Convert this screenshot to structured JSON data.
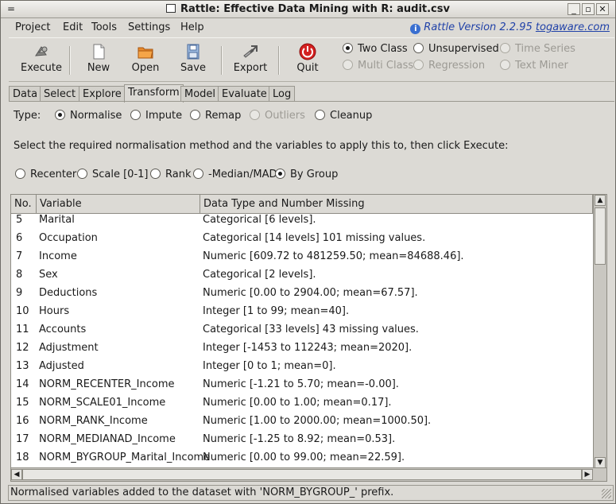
{
  "window": {
    "title": "Rattle: Effective Data Mining with R: audit.csv",
    "menu_glyph": "=",
    "btn_min": "_",
    "btn_max": "▫",
    "btn_close": "✕"
  },
  "menubar": {
    "items": [
      "Project",
      "Edit",
      "Tools",
      "Settings",
      "Help"
    ],
    "version_text": "Rattle Version 2.2.95 ",
    "version_link": "togaware.com"
  },
  "toolbar": {
    "buttons": [
      "Execute",
      "New",
      "Open",
      "Save",
      "Export",
      "Quit"
    ],
    "modes_row1": [
      "Two Class",
      "Unsupervised",
      "Time Series"
    ],
    "modes_row2": [
      "Multi Class",
      "Regression",
      "Text Miner"
    ],
    "selected_mode": "Two Class"
  },
  "tabs": [
    "Data",
    "Select",
    "Explore",
    "Transform",
    "Model",
    "Evaluate",
    "Log"
  ],
  "active_tab": "Transform",
  "type_row": {
    "label": "Type:",
    "options": [
      "Normalise",
      "Impute",
      "Remap",
      "Outliers",
      "Cleanup"
    ],
    "selected": "Normalise"
  },
  "instructions": "Select the required normalisation method and the variables to apply this to, then click Execute:",
  "methods": {
    "options": [
      "Recenter",
      "Scale [0-1]",
      "Rank",
      "-Median/MAD",
      "By Group"
    ],
    "selected": "By Group"
  },
  "table": {
    "headers": [
      "No.",
      "Variable",
      "Data Type and Number Missing"
    ],
    "rows": [
      [
        "5",
        "Marital",
        "Categorical [6 levels]."
      ],
      [
        "6",
        "Occupation",
        "Categorical [14 levels] 101 missing values."
      ],
      [
        "7",
        "Income",
        "Numeric [609.72 to 481259.50; mean=84688.46]."
      ],
      [
        "8",
        "Sex",
        "Categorical [2 levels]."
      ],
      [
        "9",
        "Deductions",
        "Numeric [0.00 to 2904.00; mean=67.57]."
      ],
      [
        "10",
        "Hours",
        "Integer [1 to 99; mean=40]."
      ],
      [
        "11",
        "Accounts",
        "Categorical [33 levels] 43 missing values."
      ],
      [
        "12",
        "Adjustment",
        "Integer [-1453 to 112243; mean=2020]."
      ],
      [
        "13",
        "Adjusted",
        "Integer [0 to 1; mean=0]."
      ],
      [
        "14",
        "NORM_RECENTER_Income",
        "Numeric [-1.21 to 5.70; mean=-0.00]."
      ],
      [
        "15",
        "NORM_SCALE01_Income",
        "Numeric [0.00 to 1.00; mean=0.17]."
      ],
      [
        "16",
        "NORM_RANK_Income",
        "Numeric [1.00 to 2000.00; mean=1000.50]."
      ],
      [
        "17",
        "NORM_MEDIANAD_Income",
        "Numeric [-1.25 to 8.92; mean=0.53]."
      ],
      [
        "18",
        "NORM_BYGROUP_Marital_Income",
        "Numeric [0.00 to 99.00; mean=22.59]."
      ]
    ]
  },
  "status": "Normalised variables added to the dataset with 'NORM_BYGROUP_' prefix."
}
